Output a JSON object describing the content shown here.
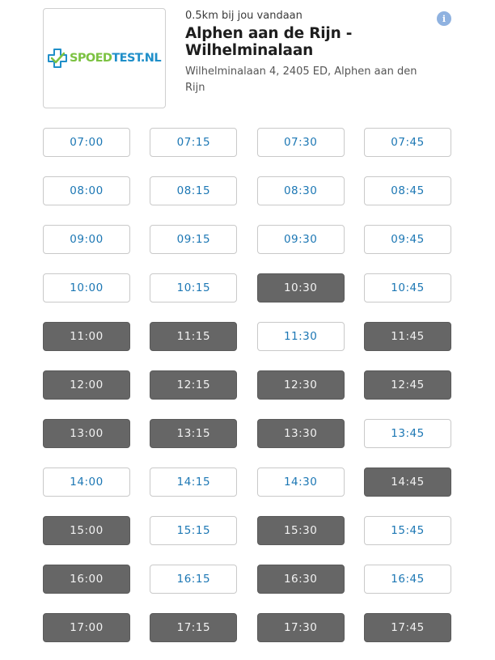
{
  "location": {
    "brand": {
      "part1": "SPOED",
      "part2": "TEST.NL"
    },
    "distance": "0.5km bij jou vandaan",
    "name": "Alphen aan de Rijn - Wilhelminalaan",
    "address": "Wilhelminalaan 4, 2405 ED, Alphen aan den Rijn"
  },
  "info_icon": {
    "glyph": "i"
  },
  "colors": {
    "available_text": "#1c77b4",
    "unavailable_bg": "#666666",
    "logo_green": "#7cc242",
    "logo_blue": "#1f8fc9"
  },
  "slots": [
    [
      {
        "time": "07:00",
        "available": true
      },
      {
        "time": "07:15",
        "available": true
      },
      {
        "time": "07:30",
        "available": true
      },
      {
        "time": "07:45",
        "available": true
      }
    ],
    [
      {
        "time": "08:00",
        "available": true
      },
      {
        "time": "08:15",
        "available": true
      },
      {
        "time": "08:30",
        "available": true
      },
      {
        "time": "08:45",
        "available": true
      }
    ],
    [
      {
        "time": "09:00",
        "available": true
      },
      {
        "time": "09:15",
        "available": true
      },
      {
        "time": "09:30",
        "available": true
      },
      {
        "time": "09:45",
        "available": true
      }
    ],
    [
      {
        "time": "10:00",
        "available": true
      },
      {
        "time": "10:15",
        "available": true
      },
      {
        "time": "10:30",
        "available": false
      },
      {
        "time": "10:45",
        "available": true
      }
    ],
    [
      {
        "time": "11:00",
        "available": false
      },
      {
        "time": "11:15",
        "available": false
      },
      {
        "time": "11:30",
        "available": true
      },
      {
        "time": "11:45",
        "available": false
      }
    ],
    [
      {
        "time": "12:00",
        "available": false
      },
      {
        "time": "12:15",
        "available": false
      },
      {
        "time": "12:30",
        "available": false
      },
      {
        "time": "12:45",
        "available": false
      }
    ],
    [
      {
        "time": "13:00",
        "available": false
      },
      {
        "time": "13:15",
        "available": false
      },
      {
        "time": "13:30",
        "available": false
      },
      {
        "time": "13:45",
        "available": true
      }
    ],
    [
      {
        "time": "14:00",
        "available": true
      },
      {
        "time": "14:15",
        "available": true
      },
      {
        "time": "14:30",
        "available": true
      },
      {
        "time": "14:45",
        "available": false
      }
    ],
    [
      {
        "time": "15:00",
        "available": false
      },
      {
        "time": "15:15",
        "available": true
      },
      {
        "time": "15:30",
        "available": false
      },
      {
        "time": "15:45",
        "available": true
      }
    ],
    [
      {
        "time": "16:00",
        "available": false
      },
      {
        "time": "16:15",
        "available": true
      },
      {
        "time": "16:30",
        "available": false
      },
      {
        "time": "16:45",
        "available": true
      }
    ],
    [
      {
        "time": "17:00",
        "available": false
      },
      {
        "time": "17:15",
        "available": false
      },
      {
        "time": "17:30",
        "available": false
      },
      {
        "time": "17:45",
        "available": false
      }
    ]
  ]
}
